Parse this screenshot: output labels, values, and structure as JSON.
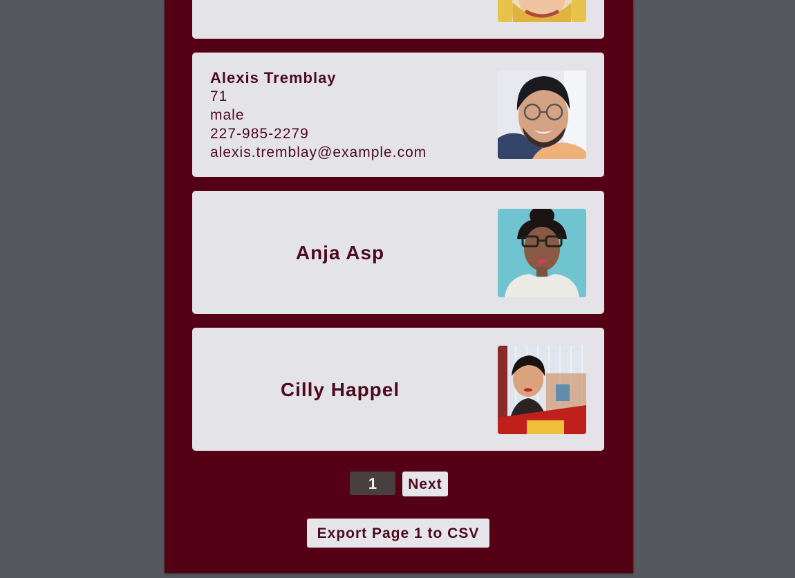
{
  "cards": [
    {
      "name": "",
      "expanded": false,
      "photo": "woman-blonde-avatar"
    },
    {
      "name": "Alexis Tremblay",
      "age": "71",
      "gender": "male",
      "phone": "227-985-2279",
      "email": "alexis.tremblay@example.com",
      "expanded": true,
      "photo": "man-glasses-beard-avatar"
    },
    {
      "name": "Anja Asp",
      "expanded": false,
      "photo": "woman-glasses-teal-avatar"
    },
    {
      "name": "Cilly Happel",
      "expanded": false,
      "photo": "woman-fairground-avatar"
    }
  ],
  "pagination": {
    "current_page": "1",
    "next_label": "Next"
  },
  "export": {
    "label": "Export Page 1 to CSV"
  },
  "colors": {
    "page_background": "#57585d",
    "panel": "#540015",
    "card": "#e3e3e8",
    "text": "#4c0a1c",
    "page_number_bg": "#48403f"
  }
}
